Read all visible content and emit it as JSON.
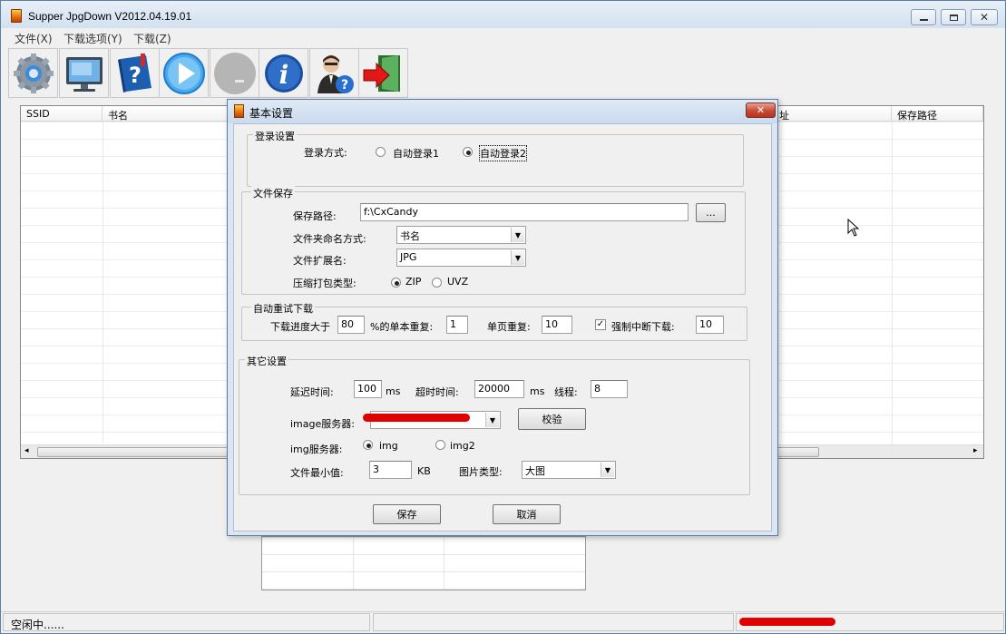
{
  "window": {
    "title": "Supper JpgDown V2012.04.19.01"
  },
  "menu": [
    "文件(X)",
    "下载选项(Y)",
    "下载(Z)"
  ],
  "toolbar": [
    {
      "name": "settings-gear-icon"
    },
    {
      "name": "monitor-icon"
    },
    {
      "name": "help-book-icon"
    },
    {
      "name": "play-icon"
    },
    {
      "name": "stop-icon"
    },
    {
      "name": "info-icon"
    },
    {
      "name": "support-person-icon"
    },
    {
      "name": "exit-door-icon"
    }
  ],
  "listview": {
    "columns": [
      "SSID",
      "书名",
      "址",
      "保存路径"
    ]
  },
  "status": {
    "left": "空闲中......"
  },
  "dialog": {
    "title": "基本设置",
    "close": "✕",
    "login": {
      "group": "登录设置",
      "label": "登录方式:",
      "options": [
        "自动登录1",
        "自动登录2"
      ],
      "selected": 1
    },
    "filesave": {
      "group": "文件保存",
      "path_label": "保存路径:",
      "path_value": "f:\\CxCandy",
      "browse": "...",
      "folder_label": "文件夹命名方式:",
      "folder_value": "书名",
      "ext_label": "文件扩展名:",
      "ext_value": "JPG",
      "archive_label": "压缩打包类型:",
      "archive_options": [
        "ZIP",
        "UVZ"
      ],
      "archive_selected": 0
    },
    "retry": {
      "group": "自动重试下载",
      "progress_label": "下载进度大于",
      "progress_value": "80",
      "single_label": "%的单本重复:",
      "single_value": "1",
      "page_label": "单页重复:",
      "page_value": "10",
      "force_label": "强制中断下载:",
      "force_checked": true,
      "force_value": "10"
    },
    "other": {
      "group": "其它设置",
      "delay_label": "延迟时间:",
      "delay_value": "100",
      "ms1": "ms",
      "timeout_label": "超时时间:",
      "timeout_value": "20000",
      "ms2": "ms",
      "threads_label": "线程:",
      "threads_value": "8",
      "image_server_label": "image服务器:",
      "verify": "校验",
      "img_server_label": "img服务器:",
      "img_options": [
        "img",
        "img2"
      ],
      "img_selected": 0,
      "minsize_label": "文件最小值:",
      "minsize_value": "3",
      "kb": "KB",
      "pictype_label": "图片类型:",
      "pictype_value": "大图"
    },
    "save": "保存",
    "cancel": "取消"
  }
}
